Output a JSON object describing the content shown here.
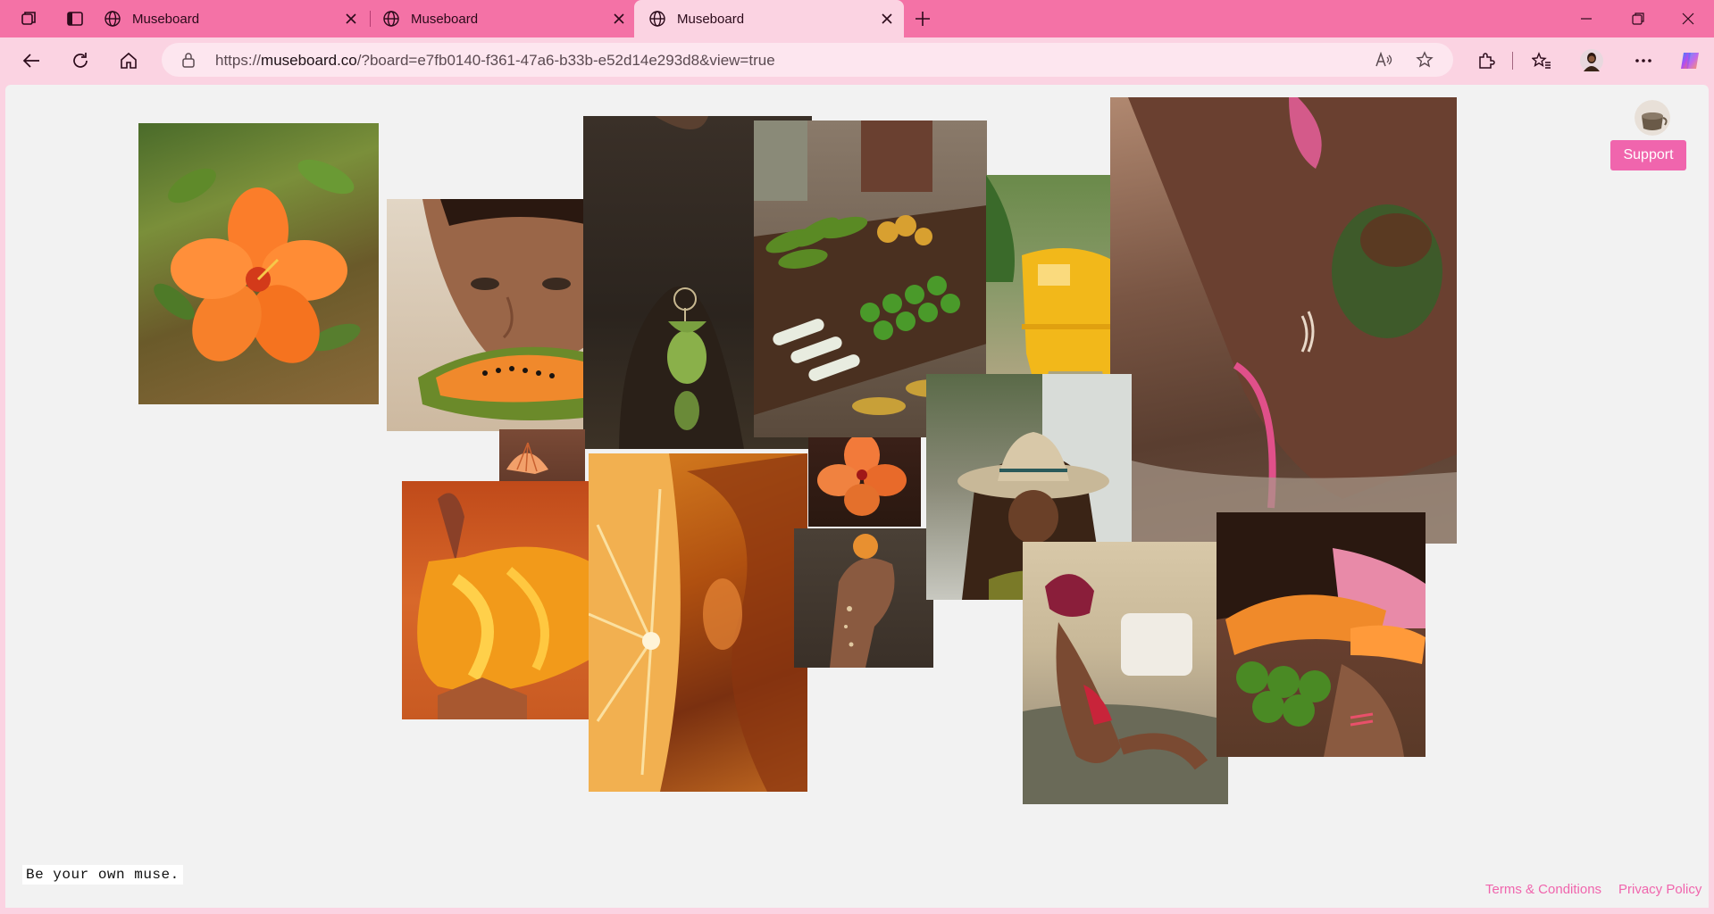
{
  "browser": {
    "tabs": [
      {
        "title": "Museboard",
        "active": false
      },
      {
        "title": "Museboard",
        "active": false
      },
      {
        "title": "Museboard",
        "active": true
      }
    ],
    "url_prefix": "https://",
    "url_host": "museboard.co",
    "url_rest": "/?board=e7fb0140-f361-47a6-b33b-e52d14e293d8&view=true",
    "icons": [
      "workspaces-icon",
      "tab-actions-icon",
      "back-icon",
      "refresh-icon",
      "home-icon",
      "lock-icon",
      "read-aloud-icon",
      "favorite-icon",
      "extensions-icon",
      "favorites-icon",
      "profile-icon",
      "more-icon",
      "copilot-icon",
      "minimize-icon",
      "restore-icon",
      "close-icon",
      "new-tab-icon"
    ],
    "accent": "#f472a6"
  },
  "page": {
    "photos": [
      {
        "name": "photo-hibiscus-flower",
        "subject": "orange hibiscus flower"
      },
      {
        "name": "photo-woman-papaya",
        "subject": "woman eating papaya"
      },
      {
        "name": "photo-earring-closeup",
        "subject": "green stone earring"
      },
      {
        "name": "photo-fruit-cart",
        "subject": "market cart with bananas and limes"
      },
      {
        "name": "photo-yellow-chair",
        "subject": "yellow plastic chair under palms"
      },
      {
        "name": "photo-coconut-bikini",
        "subject": "woman holding coconut in water"
      },
      {
        "name": "photo-seashell",
        "subject": "seashell"
      },
      {
        "name": "photo-orange-skirt",
        "subject": "orange flowing skirt"
      },
      {
        "name": "photo-citrus-slice",
        "subject": "orange slice in iced drink"
      },
      {
        "name": "photo-hibiscus-small",
        "subject": "hibiscus flower"
      },
      {
        "name": "photo-squeezed-fruit",
        "subject": "hand squeezing fruit"
      },
      {
        "name": "photo-cowboy-hat",
        "subject": "woman in cowboy hat"
      },
      {
        "name": "photo-bandana-lounge",
        "subject": "woman lounging with bandana"
      },
      {
        "name": "photo-papaya-arms",
        "subject": "arms holding papaya and fruit"
      }
    ],
    "support_label": "Support",
    "tagline": "Be your own muse.",
    "terms_label": "Terms & Conditions",
    "privacy_label": "Privacy Policy",
    "link_color": "#f065ad"
  }
}
